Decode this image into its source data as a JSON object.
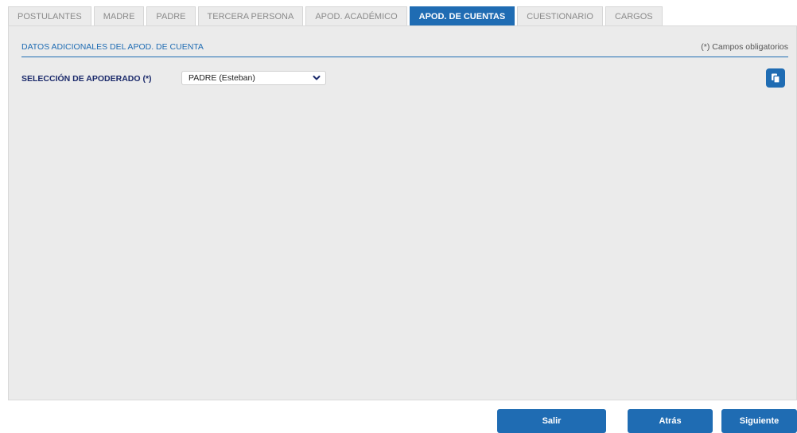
{
  "tabs": [
    {
      "label": "POSTULANTES",
      "active": false
    },
    {
      "label": "MADRE",
      "active": false
    },
    {
      "label": "PADRE",
      "active": false
    },
    {
      "label": "TERCERA PERSONA",
      "active": false
    },
    {
      "label": "APOD. ACADÉMICO",
      "active": false
    },
    {
      "label": "APOD. DE CUENTAS",
      "active": true
    },
    {
      "label": "CUESTIONARIO",
      "active": false
    },
    {
      "label": "CARGOS",
      "active": false
    }
  ],
  "section": {
    "title": "DATOS ADICIONALES DEL APOD. DE CUENTA",
    "required_note": "(*) Campos obligatorios"
  },
  "form": {
    "guardian_label": "SELECCIÓN DE APODERADO (*)",
    "guardian_value": "PADRE (Esteban)",
    "copy_icon": "copy-icon",
    "chevron_icon": "chevron-down-icon"
  },
  "footer": {
    "exit_label": "Salir",
    "back_label": "Atrás",
    "next_label": "Siguiente"
  },
  "colors": {
    "accent": "#1f6cb3",
    "panel_bg": "#ebebeb",
    "label_dark": "#1b2a6b"
  }
}
